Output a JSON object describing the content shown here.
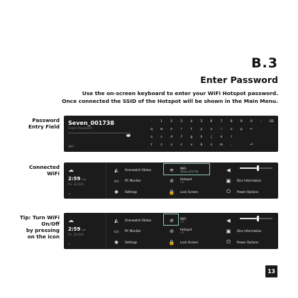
{
  "header": {
    "section_number": "B.3",
    "title": "Enter Password",
    "intro_line1": "Use the on-screen keyboard to enter your WiFi Hotspot password.",
    "intro_line2": "Once connected the SSID of the Hotspot will be shown in the Main Menu."
  },
  "labels": {
    "password_entry": [
      "Password",
      "Entry Field"
    ],
    "connected_wifi": [
      "Connected",
      "WiFi"
    ],
    "tip": [
      "Tip: Turn WiFi",
      "On/Off",
      "by pressing",
      "on the icon"
    ]
  },
  "keyboard_panel": {
    "ssid": "Seven_001738",
    "password_placeholder": "Enter Password",
    "wifi_tag": "WiFi",
    "key_rows": [
      [
        "-",
        "1",
        "2",
        "3",
        "4",
        "5",
        "6",
        "7",
        "8",
        "9",
        "0",
        "-",
        "⌫"
      ],
      [
        "q",
        "w",
        "e",
        "r",
        "t",
        "y",
        "u",
        "i",
        "o",
        "p",
        "↵",
        "",
        ""
      ],
      [
        "a",
        "s",
        "d",
        "f",
        "g",
        "h",
        "j",
        "k",
        "l",
        "",
        "",
        "",
        ""
      ],
      [
        "⇧",
        "z",
        "x",
        "c",
        "v",
        "b",
        "n",
        "m",
        ",",
        ".",
        "⏎",
        "",
        ""
      ]
    ]
  },
  "status_panel": {
    "time": "2:59",
    "ampm": "pm",
    "date": "Fri, 22 Oct",
    "tiles": {
      "overwatch": "Overwatch Status",
      "pc_monitor": "PC Monitor",
      "settings": "Settings",
      "hotspot": "Hotspot",
      "hotspot_state": "Off",
      "lock_screen": "Lock Screen",
      "disc_information": "Disc Information",
      "power_options": "Power Options"
    },
    "connected_wifi": {
      "title": "WiFi",
      "ssid": "Seven_001738"
    },
    "tip_wifi": {
      "title": "WiFi",
      "ssid": "Off"
    },
    "volume_level": 0.55
  },
  "page_number": "13"
}
